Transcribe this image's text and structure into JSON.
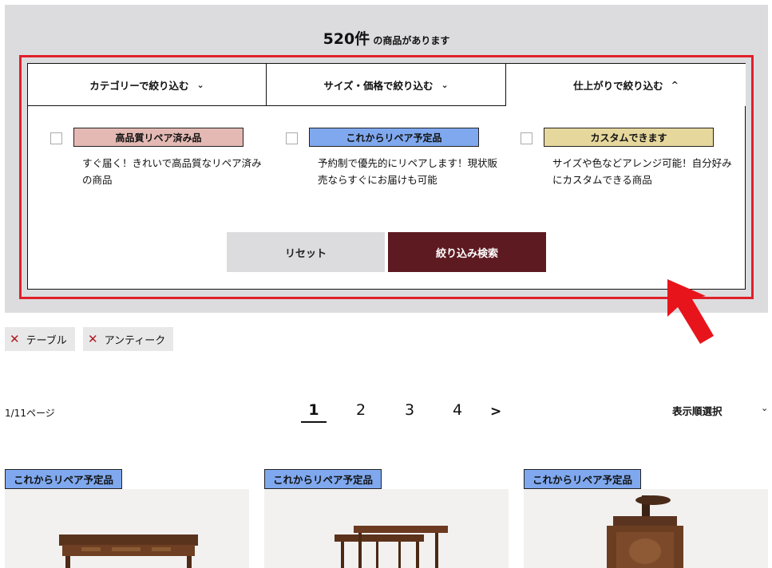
{
  "results": {
    "count": "520件",
    "suffix": " の商品があります"
  },
  "tabs": [
    {
      "label": "カテゴリーで絞り込む",
      "chevron": "⌄"
    },
    {
      "label": "サイズ・価格で絞り込む",
      "chevron": "⌄"
    },
    {
      "label": "仕上がりで絞り込む",
      "chevron": "^"
    }
  ],
  "options": [
    {
      "label": "高品質リペア済み品",
      "description": "すぐ届く！きれいで高品質なリペア済みの商品",
      "color": "#e4b9b4"
    },
    {
      "label": "これからリペア予定品",
      "description": "予約制で優先的にリペアします！現状販売ならすぐにお届けも可能",
      "color": "#7fa8ee"
    },
    {
      "label": "カスタムできます",
      "description": "サイズや色などアレンジ可能！自分好みにカスタムできる商品",
      "color": "#e6d79d"
    }
  ],
  "buttons": {
    "reset": "リセット",
    "search": "絞り込み検索"
  },
  "active_filters": [
    {
      "label": "テーブル"
    },
    {
      "label": "アンティーク"
    }
  ],
  "pagination": {
    "info": "1/11ページ",
    "pages": [
      "1",
      "2",
      "3",
      "4"
    ],
    "next": ">"
  },
  "sort": {
    "label": "表示順選択",
    "chevron": "⌄"
  },
  "products": [
    {
      "badge": "これからリペア予定品"
    },
    {
      "badge": "これからリペア予定品"
    },
    {
      "badge": "これからリペア予定品"
    }
  ],
  "colors": {
    "panel_bg": "#dcdcdf",
    "highlight": "#e0202a",
    "search_button": "#5e1a21",
    "chip_x": "#b01822"
  }
}
